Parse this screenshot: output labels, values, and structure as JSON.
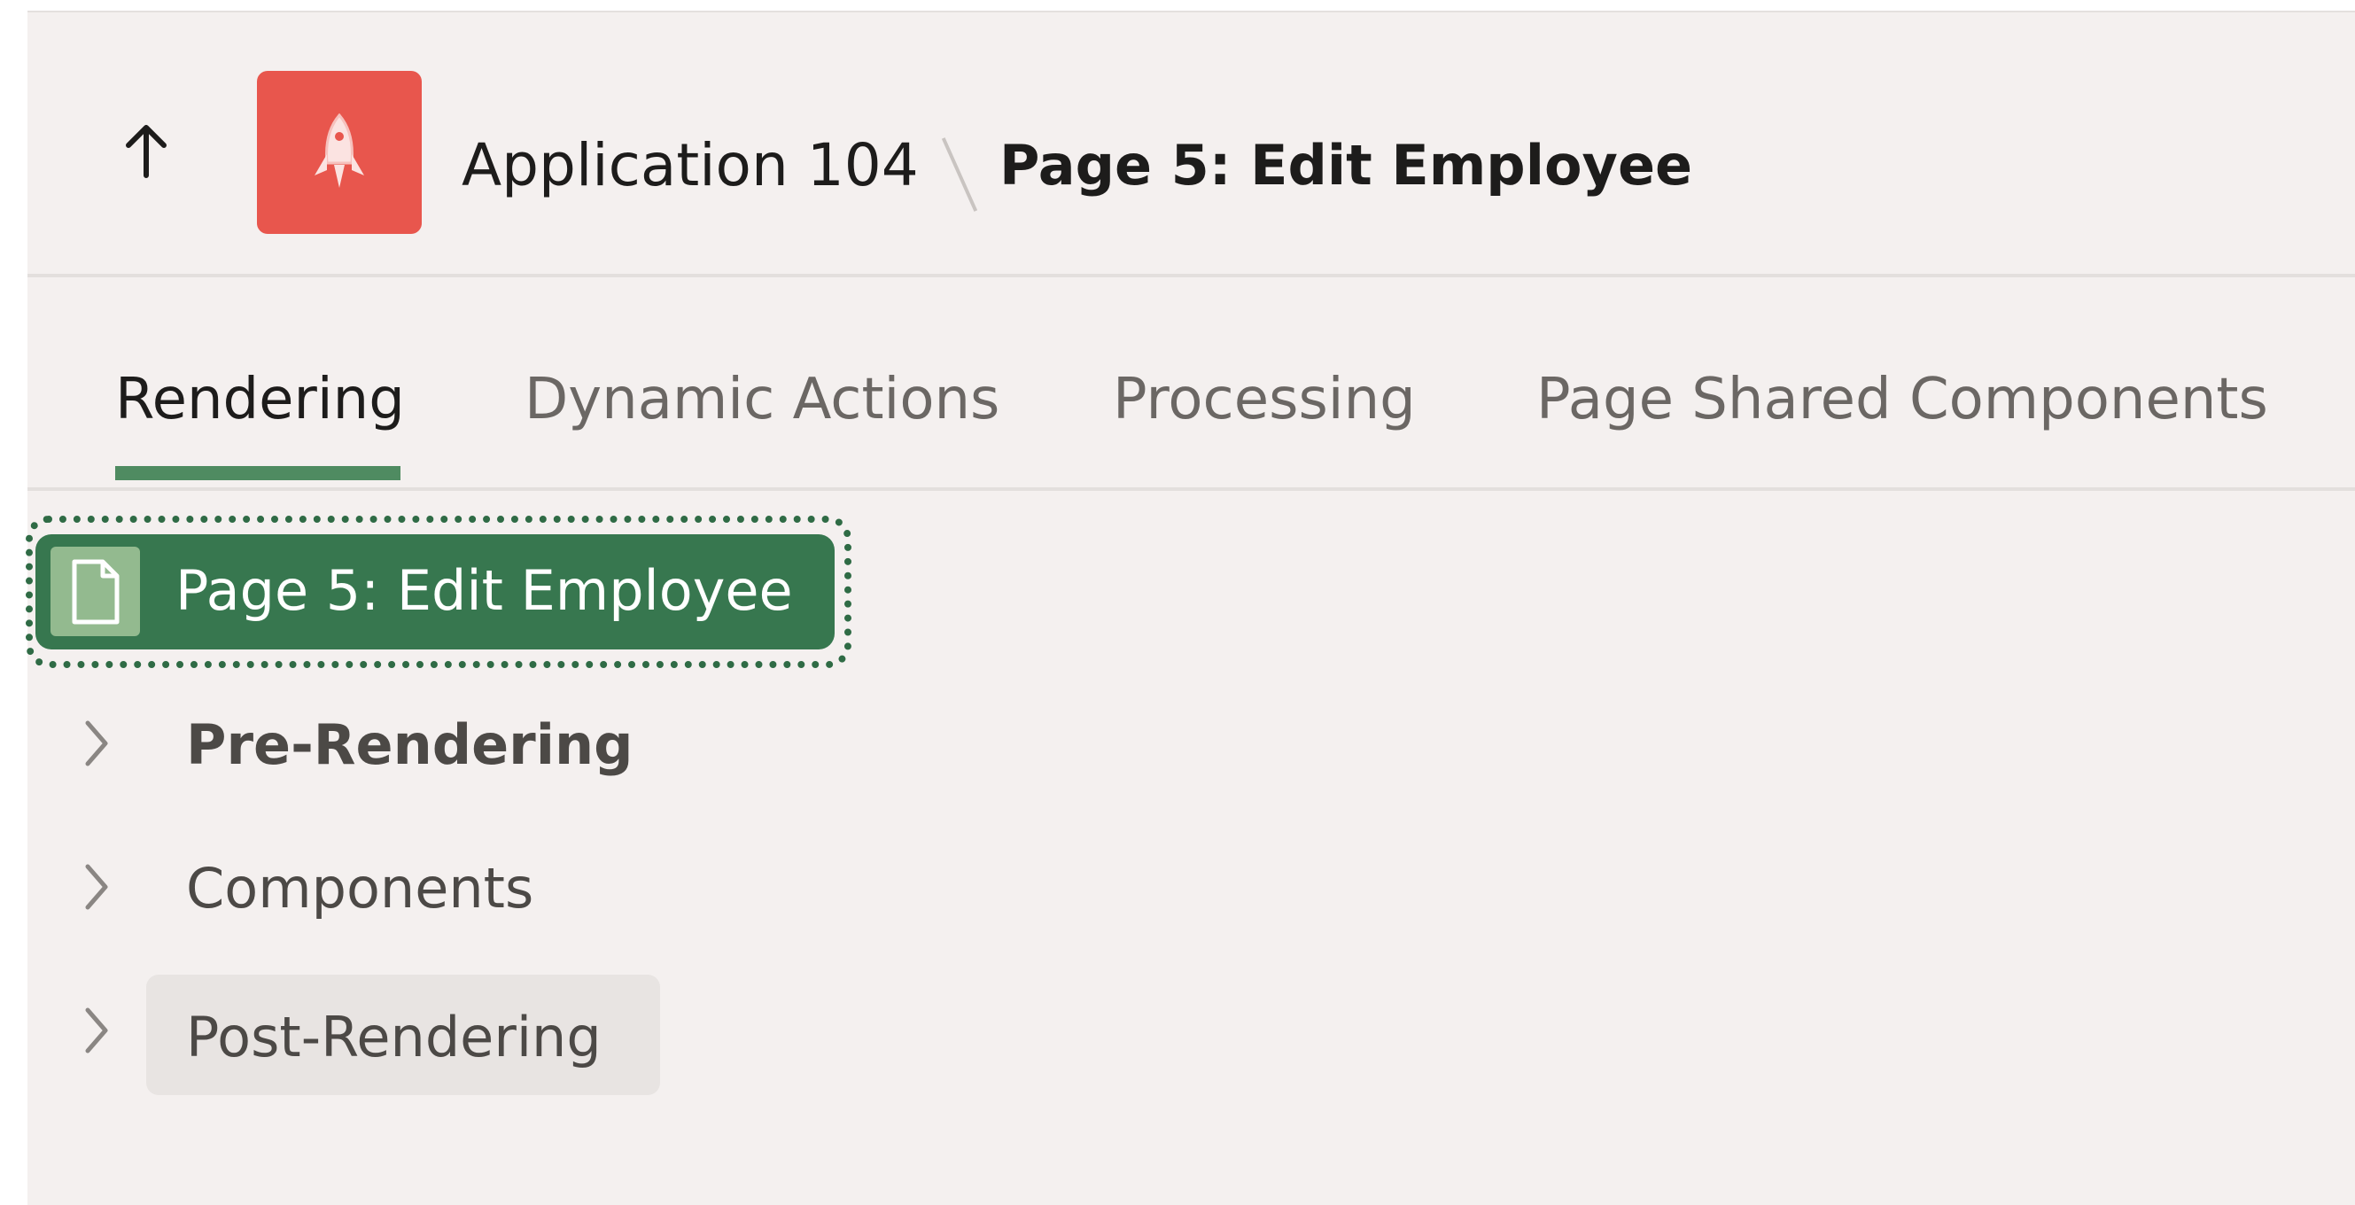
{
  "header": {
    "up_icon": "arrow-up-icon",
    "app_icon": "rocket-icon",
    "app_tile_color": "#e8564d",
    "breadcrumb_app": "Application 104",
    "breadcrumb_page": "Page 5: Edit Employee"
  },
  "tabs": [
    {
      "label": "Rendering",
      "active": true
    },
    {
      "label": "Dynamic Actions",
      "active": false
    },
    {
      "label": "Processing",
      "active": false
    },
    {
      "label": "Page Shared Components",
      "active": false
    }
  ],
  "accent_color": "#37774f",
  "tree": {
    "root": {
      "label": "Page 5: Edit Employee",
      "icon": "page-icon",
      "selected": true
    },
    "nodes": [
      {
        "label": "Pre-Rendering",
        "bold": true,
        "expanded": false
      },
      {
        "label": "Components",
        "bold": false,
        "expanded": false
      },
      {
        "label": "Post-Rendering",
        "bold": false,
        "expanded": false,
        "hovered": true
      }
    ]
  }
}
